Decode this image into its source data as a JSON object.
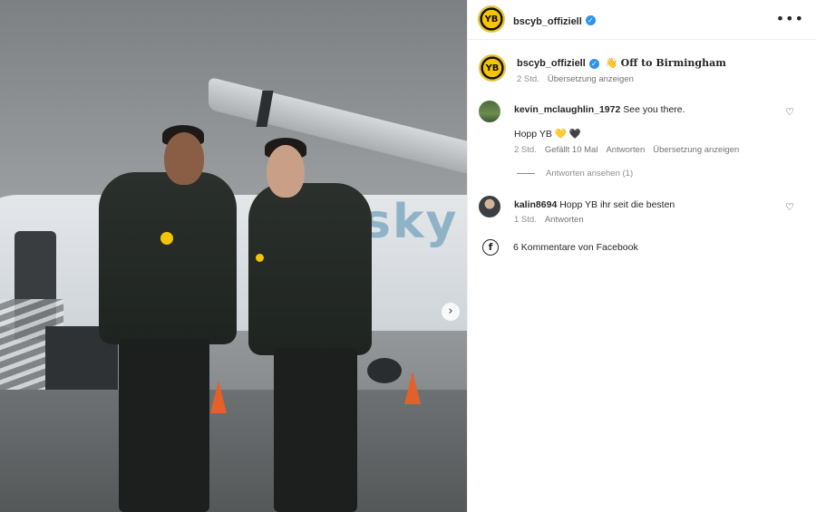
{
  "post": {
    "author": "bscyb_offiziell",
    "author_avatar_text": "YB",
    "verified_mark": "✓",
    "more_icon": "•••"
  },
  "caption": {
    "author": "bscyb_offiziell",
    "emoji": "👋",
    "text": "Off to Birmingham",
    "time": "2 Std.",
    "translate": "Übersetzung anzeigen"
  },
  "comments": [
    {
      "user": "kevin_mclaughlin_1972",
      "text": "See you there.",
      "text2": "Hopp YB 💛 🖤",
      "time": "2 Std.",
      "likes": "Gefällt 10 Mal",
      "reply": "Antworten",
      "translate": "Übersetzung anzeigen",
      "view_replies": "Antworten ansehen (1)"
    },
    {
      "user": "kalin8694",
      "text": "Hopp YB ihr seit die besten",
      "time": "1 Std.",
      "reply": "Antworten"
    }
  ],
  "facebook": {
    "icon": "f",
    "label": "6 Kommentare von Facebook"
  },
  "photo": {
    "next_icon": "›",
    "logo_text": "sky"
  },
  "icons": {
    "heart": "♡"
  },
  "colors": {
    "accent_yellow": "#f6c400",
    "verified_blue": "#2f93f0",
    "muted": "#8e8e8e"
  }
}
